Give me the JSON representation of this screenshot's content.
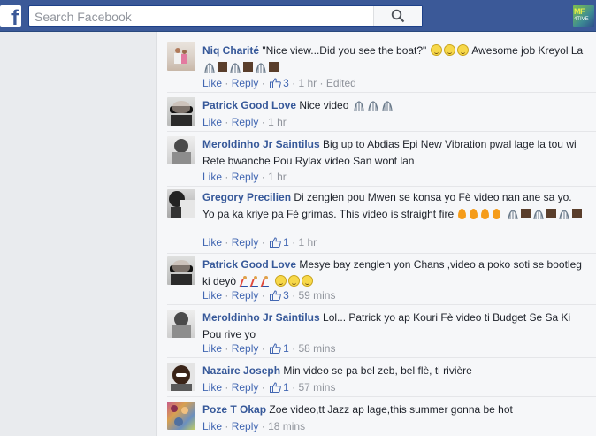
{
  "topbar": {
    "logo": "f",
    "search_placeholder": "Search Facebook",
    "profile_badge_top": "MF",
    "profile_badge_bottom": "4TIVE"
  },
  "labels": {
    "like": "Like",
    "reply": "Reply",
    "dot": "·"
  },
  "comments": [
    {
      "name": "Niq Charité",
      "text": "\"Nice view...Did you see the boat?\"",
      "text2": "Awesome job Kreyol La",
      "likes": "3",
      "time": "1 hr",
      "edited": "Edited"
    },
    {
      "name": "Patrick Good Love",
      "text": "Nice video",
      "time": "1 hr"
    },
    {
      "name": "Meroldinho Jr Saintilus",
      "text": "Big up to Abdias Epi New Vibration pwal lage la tou wi Rete bwanche Pou Rylax video San wont lan",
      "time": "1 hr"
    },
    {
      "name": "Gregory Precilien",
      "text": "Di zenglen pou Mwen se konsa yo Fè video nan ane sa yo. Yo pa ka kriye pa Fè grimas. This video is straight fire",
      "likes": "1",
      "time": "1 hr"
    },
    {
      "name": "Patrick Good Love",
      "text": "Mesye bay zenglen yon Chans ,video a poko soti se bootleg ki deyò",
      "likes": "3",
      "time": "59 mins"
    },
    {
      "name": "Meroldinho Jr Saintilus",
      "text": "Lol... Patrick yo ap Kouri Fè video ti Budget Se Sa Ki Pou rive yo",
      "likes": "1",
      "time": "58 mins"
    },
    {
      "name": "Nazaire Joseph",
      "text": "Min video se pa bel zeb, bel flè, ti rivière",
      "likes": "1",
      "time": "57 mins"
    },
    {
      "name": "Poze T Okap",
      "text": "Zoe video,tt Jazz ap lage,this summer gonna be hot",
      "time": "18 mins"
    }
  ],
  "colors": {
    "brand": "#3b5998",
    "link": "#365899",
    "muted": "#90949c"
  }
}
